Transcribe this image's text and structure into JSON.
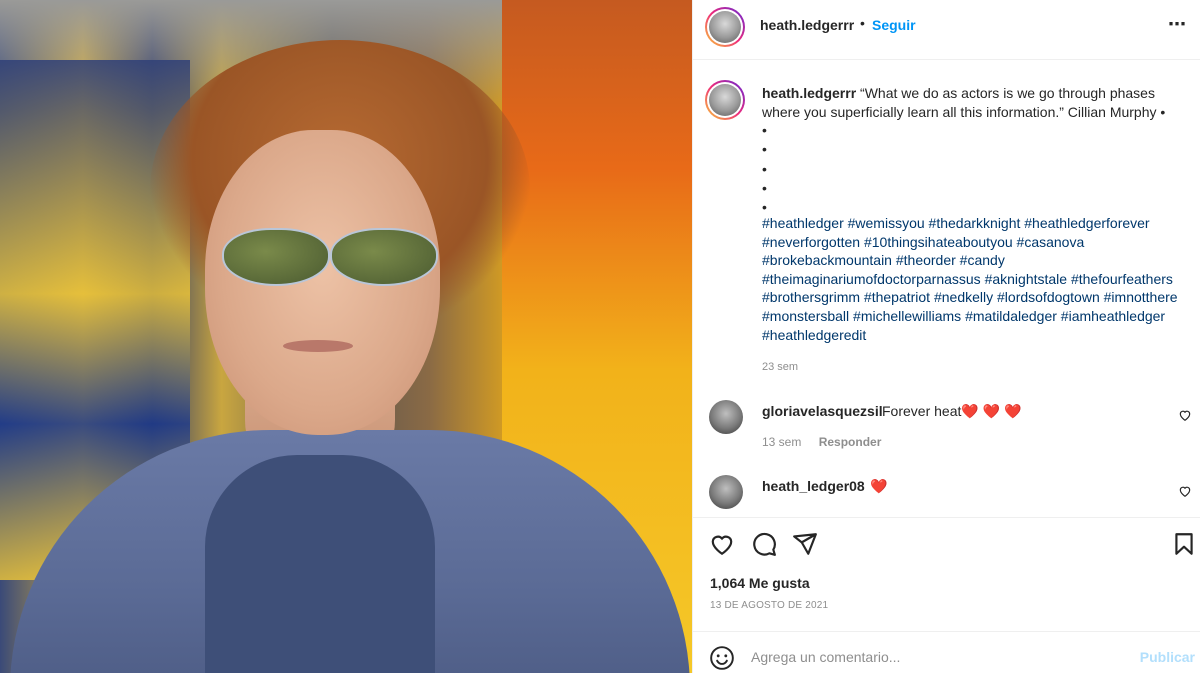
{
  "post": {
    "username": "heath.ledgerrr",
    "separator": "•",
    "follow_label": "Seguir",
    "more_icon": "⋯"
  },
  "caption": {
    "username": "heath.ledgerrr",
    "text": "“What we do as actors is we go through phases where you superficially learn all this information.” Cillian Murphy •",
    "bullets": [
      "•",
      "•",
      "•",
      "•",
      "•"
    ],
    "hashtags": "#heathledger #wemissyou #thedarkknight #heathledgerforever #neverforgotten #10thingsihateaboutyou #casanova #brokebackmountain #theorder #candy #theimaginariumofdoctorparnassus #aknightstale #thefourfeathers #brothersgrimm #thepatriot #nedkelly #lordsofdogtown #imnotthere #monstersball #michellewilliams #matildaledger #iamheathledger #heathledgeredit",
    "time": "23 sem"
  },
  "comments": [
    {
      "username": "gloriavelasquezsil",
      "text": "Forever heat",
      "hearts": "❤️ ❤️ ❤️",
      "time": "13 sem",
      "reply_label": "Responder"
    },
    {
      "username": "heath_ledger08",
      "text": "",
      "hearts": "❤️"
    }
  ],
  "stats": {
    "likes": "1,064 Me gusta",
    "date": "13 DE AGOSTO DE 2021"
  },
  "composer": {
    "placeholder": "Agrega un comentario...",
    "post_label": "Publicar"
  },
  "colors": {
    "accent": "#0095f6",
    "link": "#00376b",
    "muted": "#8e8e8e",
    "heart": "#ed1c24",
    "publish_disabled": "#b2dffc"
  }
}
